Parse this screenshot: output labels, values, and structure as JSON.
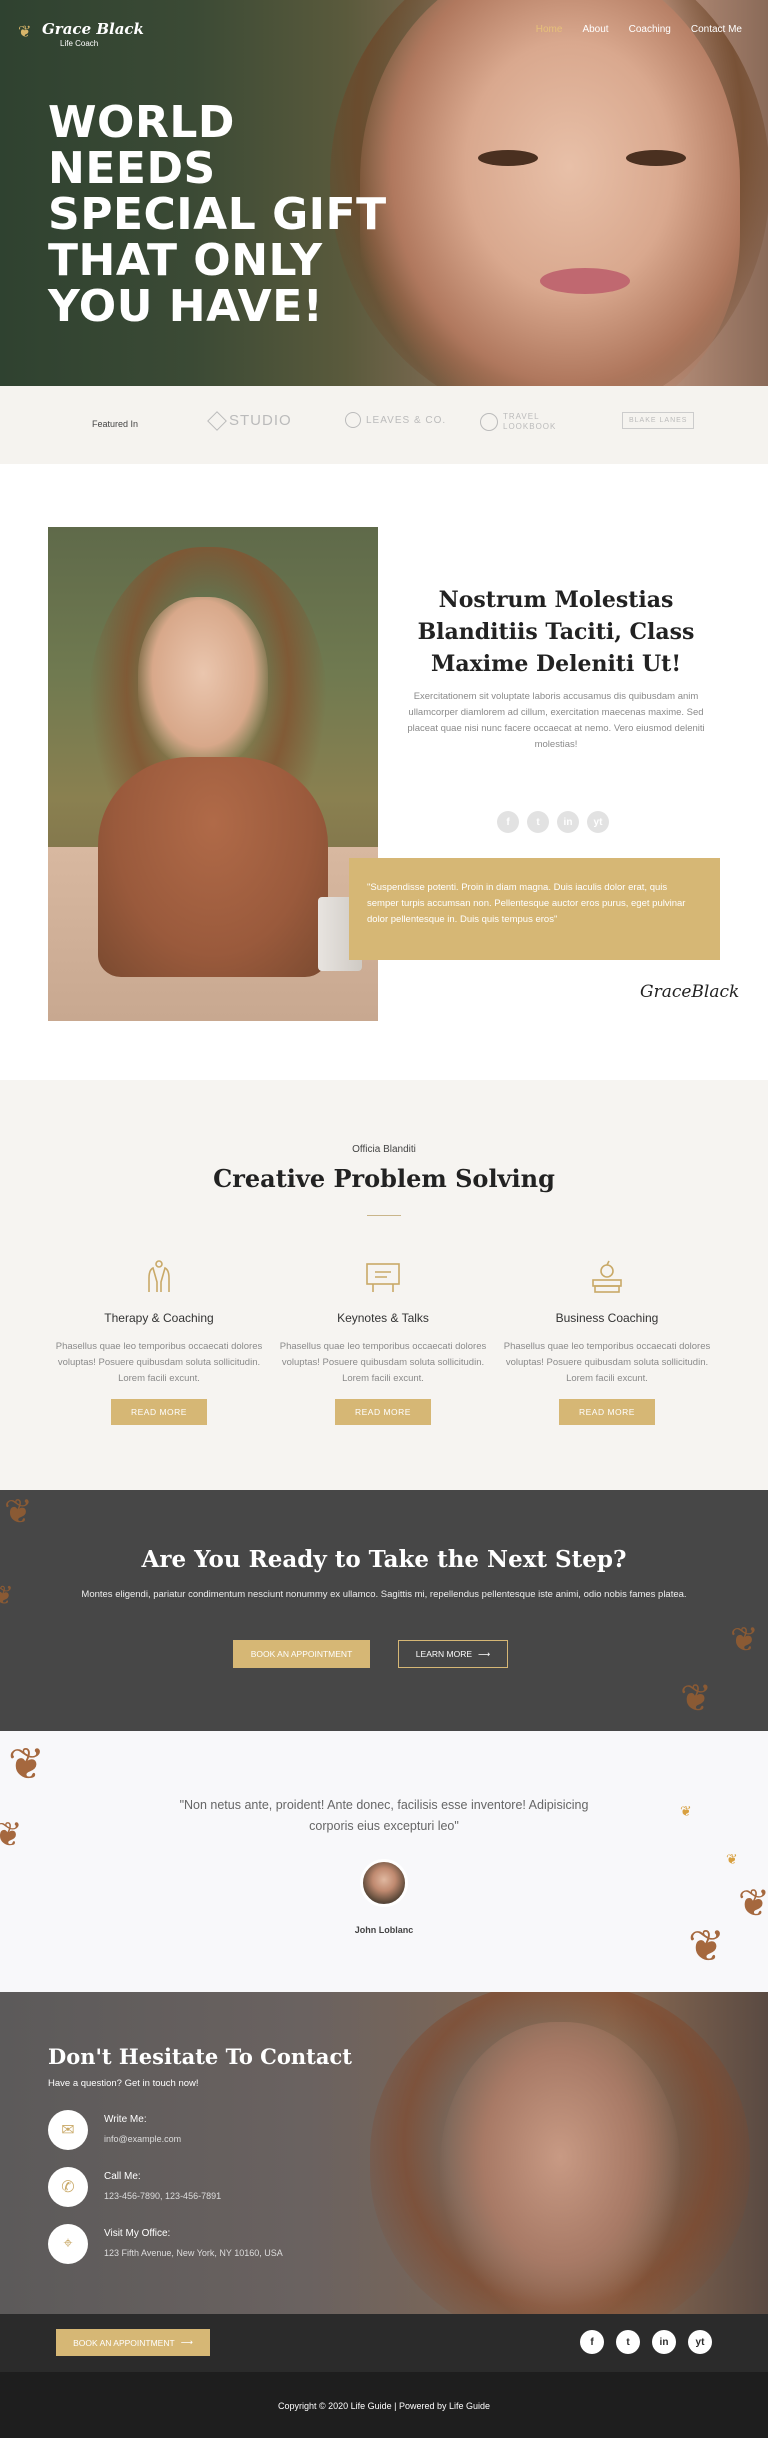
{
  "header": {
    "logo_name": "Grace Black",
    "logo_sub": "Life Coach",
    "nav": [
      "Home",
      "About",
      "Coaching",
      "Contact Me"
    ]
  },
  "hero": {
    "title_lines": [
      "WORLD NEEDS",
      "SPECIAL GIFT",
      "THAT ONLY",
      "YOU HAVE!"
    ]
  },
  "featured": {
    "label": "Featured In",
    "brands": [
      "STUDIO",
      "LEAVES & CO.",
      "TRAVEL LOOKBOOK",
      "BLAKE LANES"
    ]
  },
  "about": {
    "title": "Nostrum Molestias Blanditiis Taciti, Class Maxime Deleniti Ut!",
    "text": "Exercitationem sit voluptate laboris accusamus dis quibusdam anim ullamcorper diamlorem ad cillum, exercitation maecenas maxime. Sed placeat quae nisi nunc facere occaecat at nemo. Vero eiusmod deleniti molestias!",
    "socials": [
      "f",
      "t",
      "in",
      "yt"
    ],
    "quote": "\"Suspendisse potenti. Proin in diam magna. Duis iaculis dolor erat, quis semper turpis accumsan non. Pellentesque auctor eros purus, eget pulvinar dolor pellentesque in. Duis quis tempus eros\"",
    "signature": "GraceBlack"
  },
  "services": {
    "kicker": "Officia Blanditi",
    "title": "Creative Problem Solving",
    "cards": [
      {
        "icon": "hands-icon",
        "title": "Therapy & Coaching",
        "text": "Phasellus quae leo temporibus occaecati dolores voluptas! Posuere quibusdam soluta sollicitudin. Lorem facili excunt.",
        "button": "READ MORE"
      },
      {
        "icon": "presentation-icon",
        "title": "Keynotes & Talks",
        "text": "Phasellus quae leo temporibus occaecati dolores voluptas! Posuere quibusdam soluta sollicitudin. Lorem facili excunt.",
        "button": "READ MORE"
      },
      {
        "icon": "apple-books-icon",
        "title": "Business Coaching",
        "text": "Phasellus quae leo temporibus occaecati dolores voluptas! Posuere quibusdam soluta sollicitudin. Lorem facili excunt.",
        "button": "READ MORE"
      }
    ]
  },
  "cta": {
    "title": "Are You Ready to Take the Next Step?",
    "text": "Montes eligendi, pariatur condimentum nesciunt nonummy ex ullamco. Sagittis mi, repellendus pellentesque iste animi, odio nobis fames platea.",
    "primary_button": "BOOK AN APPOINTMENT",
    "secondary_button": "LEARN MORE"
  },
  "testimonial": {
    "quote": "\"Non netus ante, proident! Ante donec, facilisis esse inventore! Adipisicing corporis eius excepturi leo\"",
    "name": "John Loblanc"
  },
  "contact": {
    "title": "Don't Hesitate To Contact",
    "subtitle": "Have a question? Get in touch now!",
    "items": [
      {
        "icon": "mail-icon",
        "label": "Write Me:",
        "value": "info@example.com"
      },
      {
        "icon": "phone-icon",
        "label": "Call Me:",
        "value": "123-456-7890, 123-456-7891"
      },
      {
        "icon": "location-icon",
        "label": "Visit My Office:",
        "value": "123 Fifth Avenue, New York, NY 10160, USA"
      }
    ]
  },
  "footer": {
    "button": "BOOK AN APPOINTMENT",
    "socials": [
      "f",
      "t",
      "in",
      "yt"
    ],
    "copyright": "Copyright © 2020 Life Guide | Powered by Life Guide"
  },
  "colors": {
    "accent": "#d6b775",
    "dark": "#474747",
    "footer": "#2b2b2b"
  }
}
